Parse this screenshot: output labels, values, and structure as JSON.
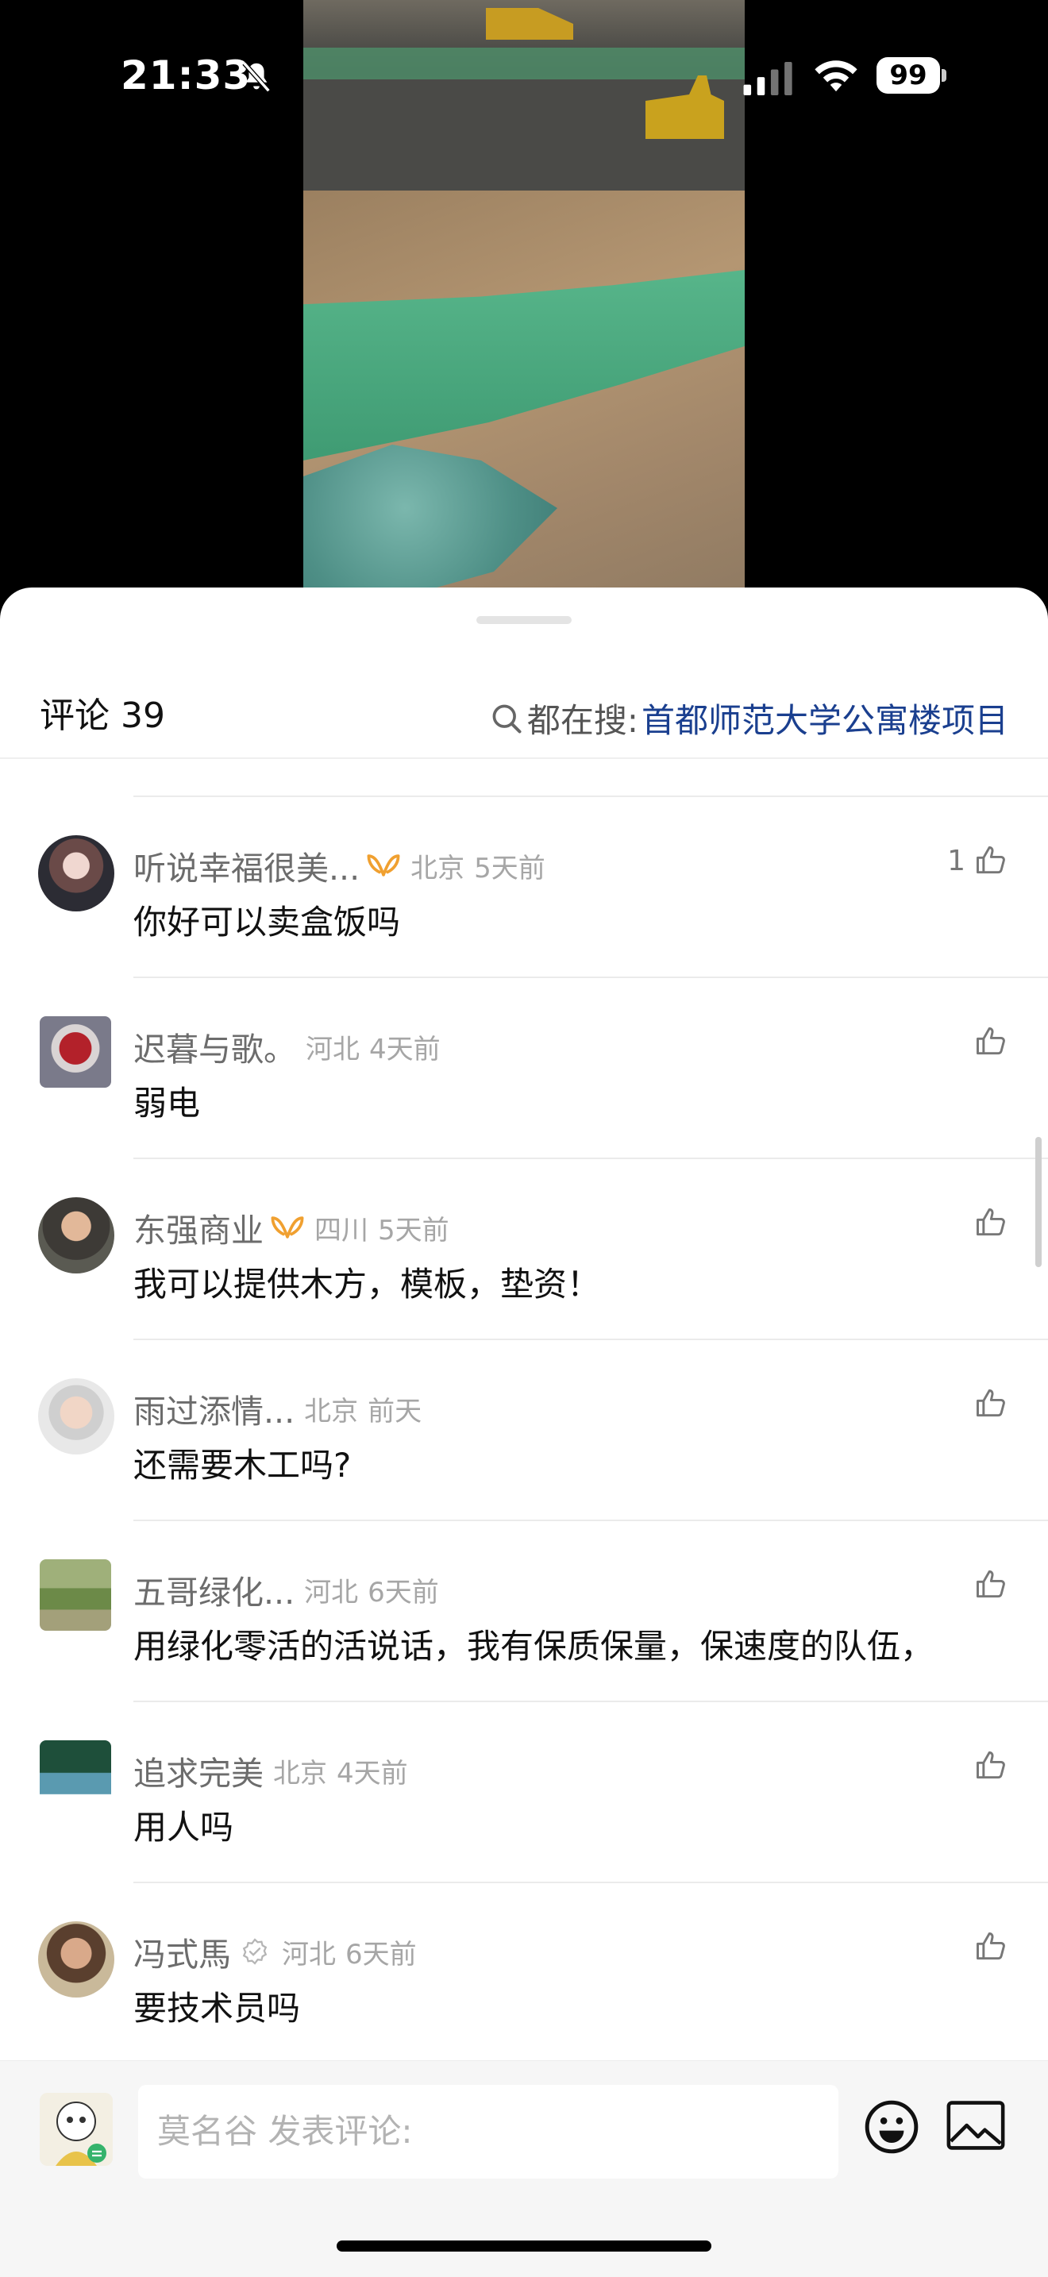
{
  "status_bar": {
    "time": "21:33",
    "battery": "99"
  },
  "header": {
    "title": "评论 39",
    "search_label": "都在搜:",
    "search_query": "首都师范大学公寓楼项目"
  },
  "comments": [
    {
      "user": "听说幸福很美...",
      "location": "北京",
      "time": "5天前",
      "text": "你好可以卖盒饭吗",
      "likes": "1"
    },
    {
      "user": "迟暮与歌。",
      "location": "河北",
      "time": "4天前",
      "text": "弱电",
      "likes": ""
    },
    {
      "user": "东强商业",
      "location": "四川",
      "time": "5天前",
      "text": "我可以提供木方，模板，垫资！",
      "likes": ""
    },
    {
      "user": "雨过添情...",
      "location": "北京",
      "time": "前天",
      "text": "还需要木工吗?",
      "likes": ""
    },
    {
      "user": "五哥绿化...",
      "location": "河北",
      "time": "6天前",
      "text": "用绿化零活的活说话，我有保质保量，保速度的队伍，",
      "likes": ""
    },
    {
      "user": "追求完美",
      "location": "北京",
      "time": "4天前",
      "text": "用人吗",
      "likes": ""
    },
    {
      "user": "冯式馬",
      "location": "河北",
      "time": "6天前",
      "text": "要技术员吗",
      "likes": ""
    }
  ],
  "composer": {
    "placeholder": "莫名谷 发表评论:"
  },
  "colors": {
    "accent_link": "#1a3f8f",
    "badge_orange": "#f0a030"
  }
}
